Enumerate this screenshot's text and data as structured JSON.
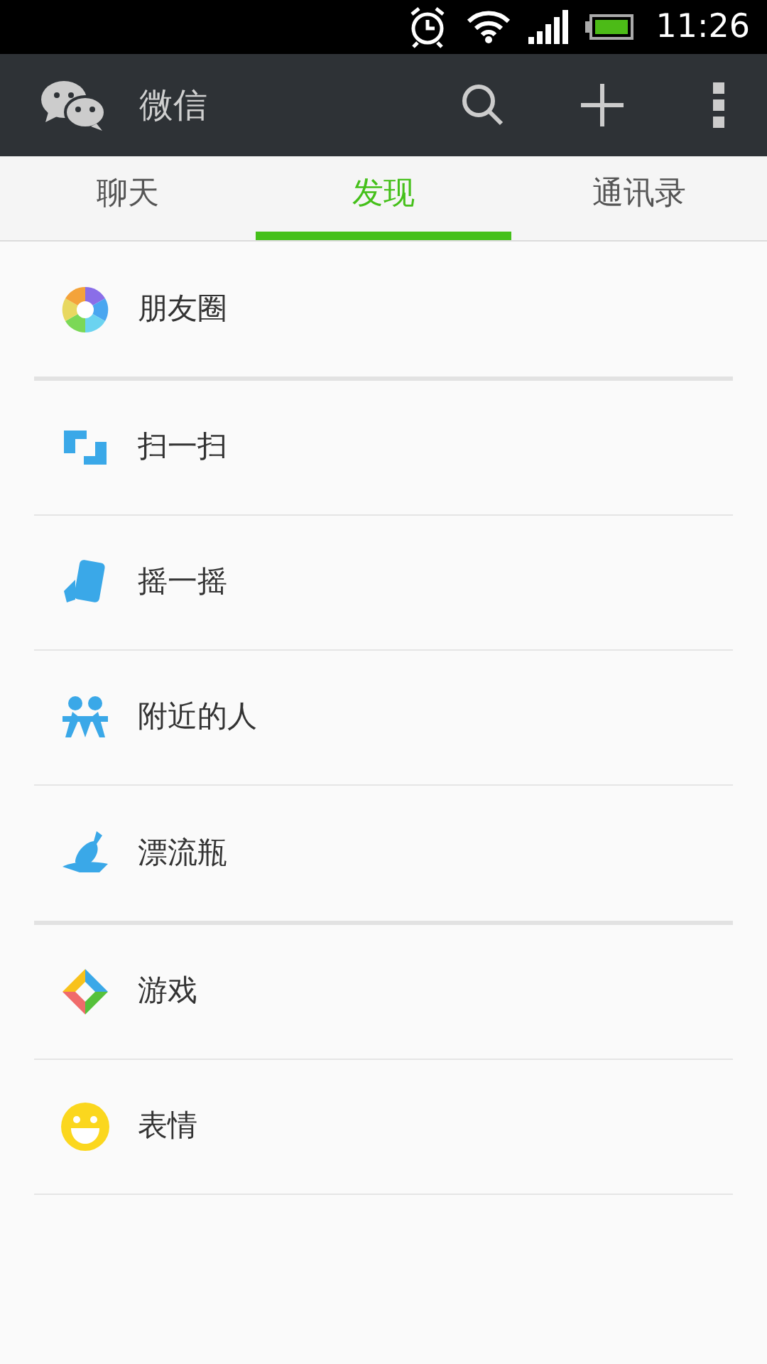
{
  "status_bar": {
    "time": "11:26"
  },
  "app_bar": {
    "title": "微信"
  },
  "tabs": [
    {
      "label": "聊天",
      "selected": false
    },
    {
      "label": "发现",
      "selected": true
    },
    {
      "label": "通讯录",
      "selected": false
    }
  ],
  "groups": [
    {
      "items": [
        {
          "label": "朋友圈"
        }
      ]
    },
    {
      "items": [
        {
          "label": "扫一扫"
        },
        {
          "label": "摇一摇"
        },
        {
          "label": "附近的人"
        },
        {
          "label": "漂流瓶"
        }
      ]
    },
    {
      "items": [
        {
          "label": "游戏"
        },
        {
          "label": "表情"
        }
      ]
    }
  ]
}
